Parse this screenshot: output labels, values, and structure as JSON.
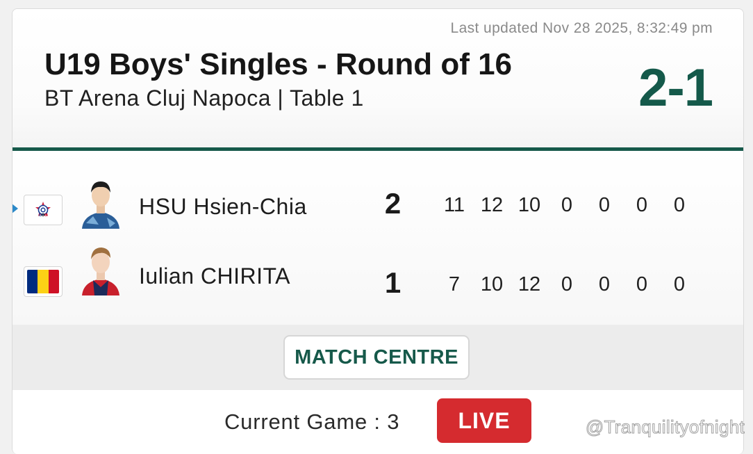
{
  "header": {
    "last_updated": "Last updated Nov 28 2025, 8:32:49 pm",
    "title": "U19 Boys' Singles - Round of 16",
    "venue": "BT Arena Cluj Napoca | Table 1",
    "match_score": "2-1"
  },
  "players": [
    {
      "name": "HSU Hsien-Chia",
      "flag": "chinese-taipei-flag-icon",
      "games_won": "2",
      "sets": [
        "11",
        "12",
        "10",
        "0",
        "0",
        "0",
        "0"
      ],
      "serving": true
    },
    {
      "name": "Iulian CHIRITA",
      "flag": "romania-flag-icon",
      "games_won": "1",
      "sets": [
        "7",
        "10",
        "12",
        "0",
        "0",
        "0",
        "0"
      ],
      "serving": false
    }
  ],
  "actions": {
    "match_centre_label": "MATCH CENTRE"
  },
  "status": {
    "current_game": "Current Game : 3",
    "live_label": "LIVE"
  },
  "watermark": "@Tranquilityofnight",
  "colors": {
    "accent_green": "#16594a",
    "live_red": "#d52b2f",
    "serve_marker_blue": "#2b89c9",
    "romania_blue": "#002b7f",
    "romania_yellow": "#fcd116",
    "romania_red": "#ce1126"
  }
}
